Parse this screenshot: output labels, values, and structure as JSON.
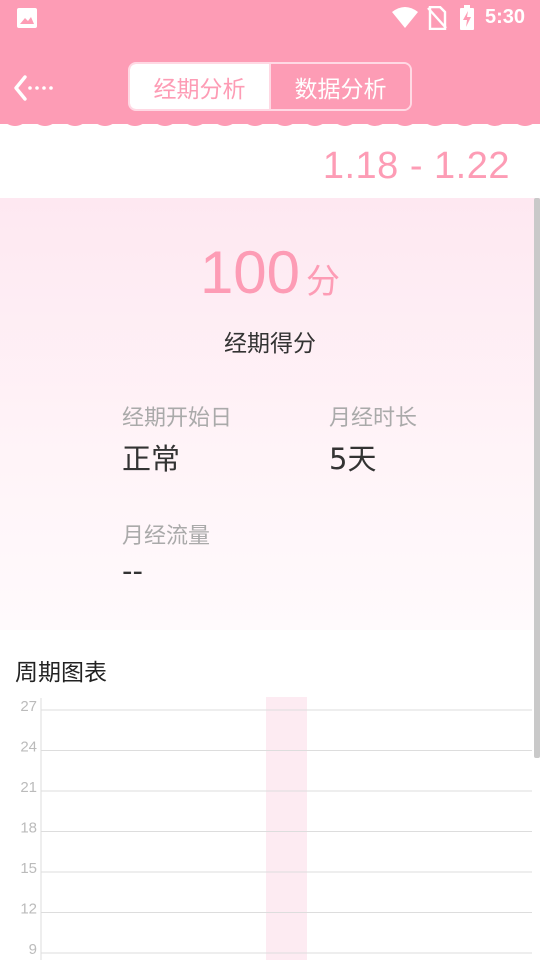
{
  "status_bar": {
    "time": "5:30",
    "icons": [
      "image-icon",
      "wifi-icon",
      "no-sim-icon",
      "battery-charging-icon"
    ]
  },
  "header": {
    "back_icon": "back-arrow-icon",
    "tabs": [
      {
        "label": "经期分析",
        "active": true
      },
      {
        "label": "数据分析",
        "active": false
      }
    ],
    "accent_color": "#fd9cb5"
  },
  "period": {
    "date_range": "1.18 - 1.22"
  },
  "score": {
    "value": "100",
    "unit": "分",
    "label": "经期得分"
  },
  "stats": {
    "start_day": {
      "label": "经期开始日",
      "value": "正常"
    },
    "duration": {
      "label": "月经时长",
      "value": "5天"
    },
    "flow": {
      "label": "月经流量",
      "value": "--"
    }
  },
  "chart_title": "周期图表",
  "chart_data": {
    "type": "bar",
    "title": "",
    "y_ticks": [
      27,
      24,
      21,
      18,
      15,
      12,
      9
    ],
    "grid": true,
    "ylim": [
      9,
      27
    ],
    "highlight_color": "#fdebf2",
    "line_color": "#dddddd",
    "tick_color": "#bbbbbb"
  }
}
